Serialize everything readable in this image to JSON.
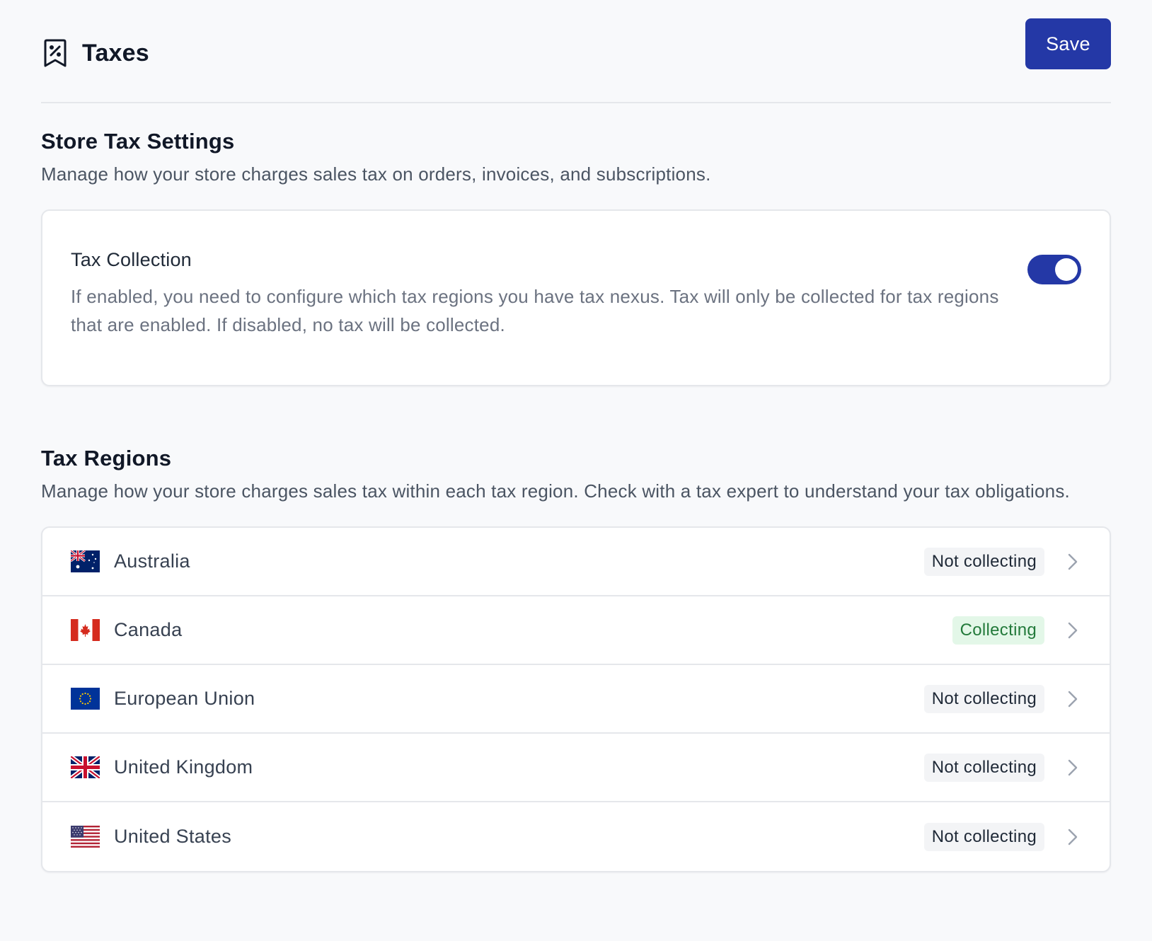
{
  "header": {
    "title": "Taxes",
    "icon": "receipt-tax-icon",
    "save_label": "Save"
  },
  "store_settings": {
    "title": "Store Tax Settings",
    "description": "Manage how your store charges sales tax on orders, invoices, and subscriptions.",
    "tax_collection": {
      "title": "Tax Collection",
      "description": "If enabled, you need to configure which tax regions you have tax nexus. Tax will only be collected for tax regions that are enabled. If disabled, no tax will be collected.",
      "enabled": true
    }
  },
  "tax_regions": {
    "title": "Tax Regions",
    "description": "Manage how your store charges sales tax within each tax region. Check with a tax expert to understand your tax obligations.",
    "items": [
      {
        "name": "Australia",
        "flag": "australia-flag-icon",
        "status": "Not collecting",
        "collecting": false
      },
      {
        "name": "Canada",
        "flag": "canada-flag-icon",
        "status": "Collecting",
        "collecting": true
      },
      {
        "name": "European Union",
        "flag": "eu-flag-icon",
        "status": "Not collecting",
        "collecting": false
      },
      {
        "name": "United Kingdom",
        "flag": "uk-flag-icon",
        "status": "Not collecting",
        "collecting": false
      },
      {
        "name": "United States",
        "flag": "us-flag-icon",
        "status": "Not collecting",
        "collecting": false
      }
    ]
  },
  "colors": {
    "accent": "#2438a6",
    "collecting_bg": "#e3f7e8",
    "collecting_text": "#237a3b",
    "not_collecting_bg": "#f3f4f6"
  }
}
